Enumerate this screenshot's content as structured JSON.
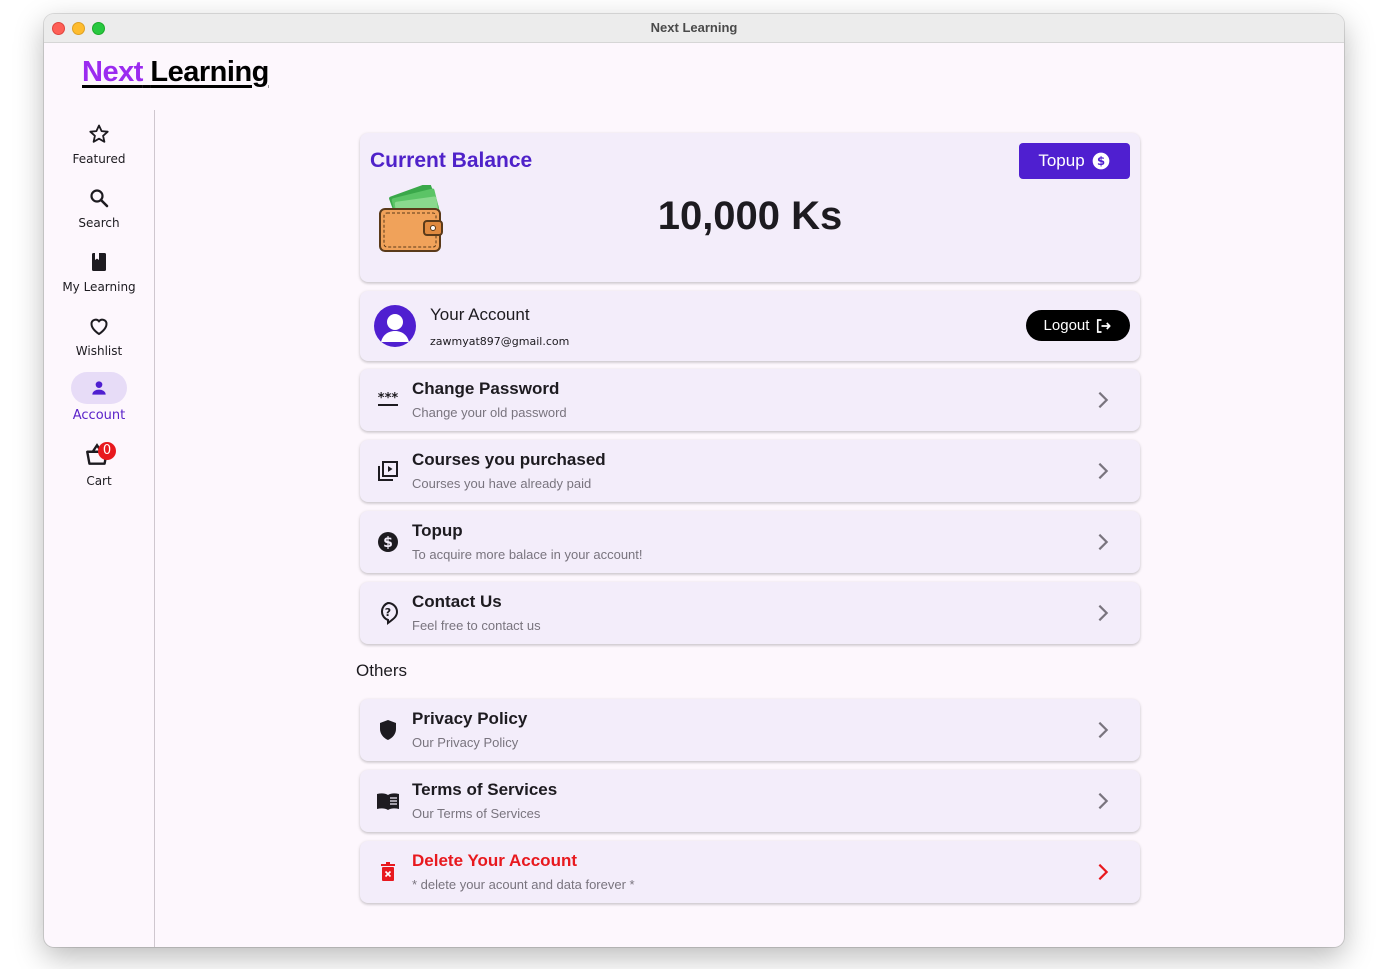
{
  "window": {
    "title": "Next Learning"
  },
  "logo": {
    "part1": "Next",
    "part2": "Learning"
  },
  "sidebar": {
    "items": [
      {
        "label": "Featured",
        "icon": "star-icon"
      },
      {
        "label": "Search",
        "icon": "search-icon"
      },
      {
        "label": "My Learning",
        "icon": "book-icon"
      },
      {
        "label": "Wishlist",
        "icon": "heart-icon"
      },
      {
        "label": "Account",
        "icon": "person-icon",
        "active": true
      },
      {
        "label": "Cart",
        "icon": "cart-icon",
        "badge": "0"
      }
    ]
  },
  "balance": {
    "title": "Current Balance",
    "amount": "10,000 Ks",
    "topup_label": "Topup",
    "icon": "wallet-icon"
  },
  "account": {
    "title": "Your Account",
    "email": "zawmyat897@gmail.com",
    "logout_label": "Logout"
  },
  "menu": [
    {
      "title": "Change Password",
      "subtitle": "Change your old password",
      "icon": "password-icon"
    },
    {
      "title": "Courses you purchased",
      "subtitle": "Courses you have already paid",
      "icon": "video-library-icon"
    },
    {
      "title": "Topup",
      "subtitle": "To acquire more balace in your account!",
      "icon": "dollar-circle-icon"
    },
    {
      "title": "Contact Us",
      "subtitle": "Feel free to contact us",
      "icon": "help-bubble-icon"
    }
  ],
  "others": {
    "heading": "Others",
    "items": [
      {
        "title": "Privacy Policy",
        "subtitle": "Our Privacy Policy",
        "icon": "shield-icon"
      },
      {
        "title": "Terms of Services",
        "subtitle": "Our Terms of Services",
        "icon": "open-book-icon"
      },
      {
        "title": "Delete Your Account",
        "subtitle": "* delete your acount and data forever *",
        "icon": "trash-icon",
        "danger": true
      }
    ]
  },
  "colors": {
    "accent": "#4f1fd0",
    "logo_purple": "#9b2bf0",
    "danger": "#e8191e",
    "card_bg": "#f3edfa",
    "page_bg": "#fdf7fd"
  }
}
